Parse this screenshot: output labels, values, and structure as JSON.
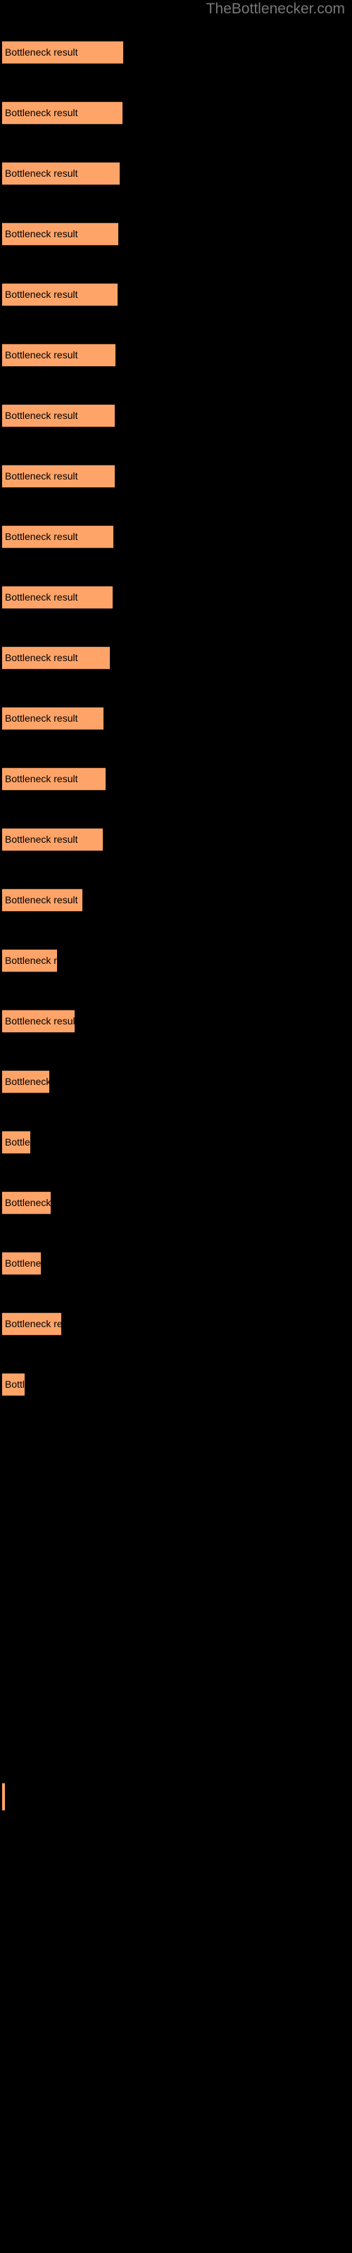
{
  "header": {
    "site_title": "TheBottlenecker.com",
    "title_color": "#777777"
  },
  "theme": {
    "background": "#000000",
    "bar_fill": "#ffa468",
    "bar_border": "#3d2a1c",
    "label_color": "#000000"
  },
  "chart_data": {
    "type": "bar",
    "orientation": "horizontal",
    "title": "TheBottlenecker.com",
    "xlabel": "",
    "ylabel": "",
    "grid": false,
    "legend": null,
    "bar_label_text": "Bottleneck result",
    "categories": [
      "Bottleneck result",
      "Bottleneck result",
      "Bottleneck result",
      "Bottleneck result",
      "Bottleneck result",
      "Bottleneck result",
      "Bottleneck result",
      "Bottleneck result",
      "Bottleneck result",
      "Bottleneck result",
      "Bottleneck result",
      "Bottleneck result",
      "Bottleneck result",
      "Bottleneck result",
      "Bottleneck result",
      "Bottleneck result",
      "Bottleneck result",
      "Bottleneck result",
      "Bottleneck result",
      "Bottleneck result",
      "Bottleneck result",
      "Bottleneck result",
      "Bottleneck result",
      "Bottleneck result"
    ],
    "values": [
      172,
      171,
      167,
      165,
      164,
      161,
      160,
      160,
      158,
      157,
      153,
      144,
      147,
      143,
      114,
      78,
      103,
      67,
      40,
      69,
      55,
      84,
      32,
      4
    ],
    "xlim": [
      0,
      500
    ],
    "bars": [
      {
        "label": "Bottleneck result",
        "value": 172,
        "top": 58
      },
      {
        "label": "Bottleneck result",
        "value": 171,
        "top": 144
      },
      {
        "label": "Bottleneck result",
        "value": 167,
        "top": 230
      },
      {
        "label": "Bottleneck result",
        "value": 165,
        "top": 316
      },
      {
        "label": "Bottleneck result",
        "value": 164,
        "top": 402
      },
      {
        "label": "Bottleneck result",
        "value": 161,
        "top": 488
      },
      {
        "label": "Bottleneck result",
        "value": 160,
        "top": 574
      },
      {
        "label": "Bottleneck result",
        "value": 160,
        "top": 660
      },
      {
        "label": "Bottleneck result",
        "value": 158,
        "top": 746
      },
      {
        "label": "Bottleneck result",
        "value": 157,
        "top": 832
      },
      {
        "label": "Bottleneck result",
        "value": 153,
        "top": 918
      },
      {
        "label": "Bottleneck result",
        "value": 144,
        "top": 1004
      },
      {
        "label": "Bottleneck result",
        "value": 147,
        "top": 1090
      },
      {
        "label": "Bottleneck result",
        "value": 143,
        "top": 1176
      },
      {
        "label": "Bottleneck result",
        "value": 114,
        "top": 1262
      },
      {
        "label": "Bottleneck result",
        "value": 78,
        "top": 1348
      },
      {
        "label": "Bottleneck result",
        "value": 103,
        "top": 1434
      },
      {
        "label": "Bottleneck result",
        "value": 67,
        "top": 1520
      },
      {
        "label": "Bottleneck result",
        "value": 40,
        "top": 1606
      },
      {
        "label": "Bottleneck result",
        "value": 69,
        "top": 1692
      },
      {
        "label": "Bottleneck result",
        "value": 55,
        "top": 1778
      },
      {
        "label": "Bottleneck result",
        "value": 84,
        "top": 1864
      },
      {
        "label": "Bottleneck result",
        "value": 32,
        "top": 1950
      },
      {
        "label": "",
        "value": 4,
        "top": 2532
      }
    ]
  }
}
